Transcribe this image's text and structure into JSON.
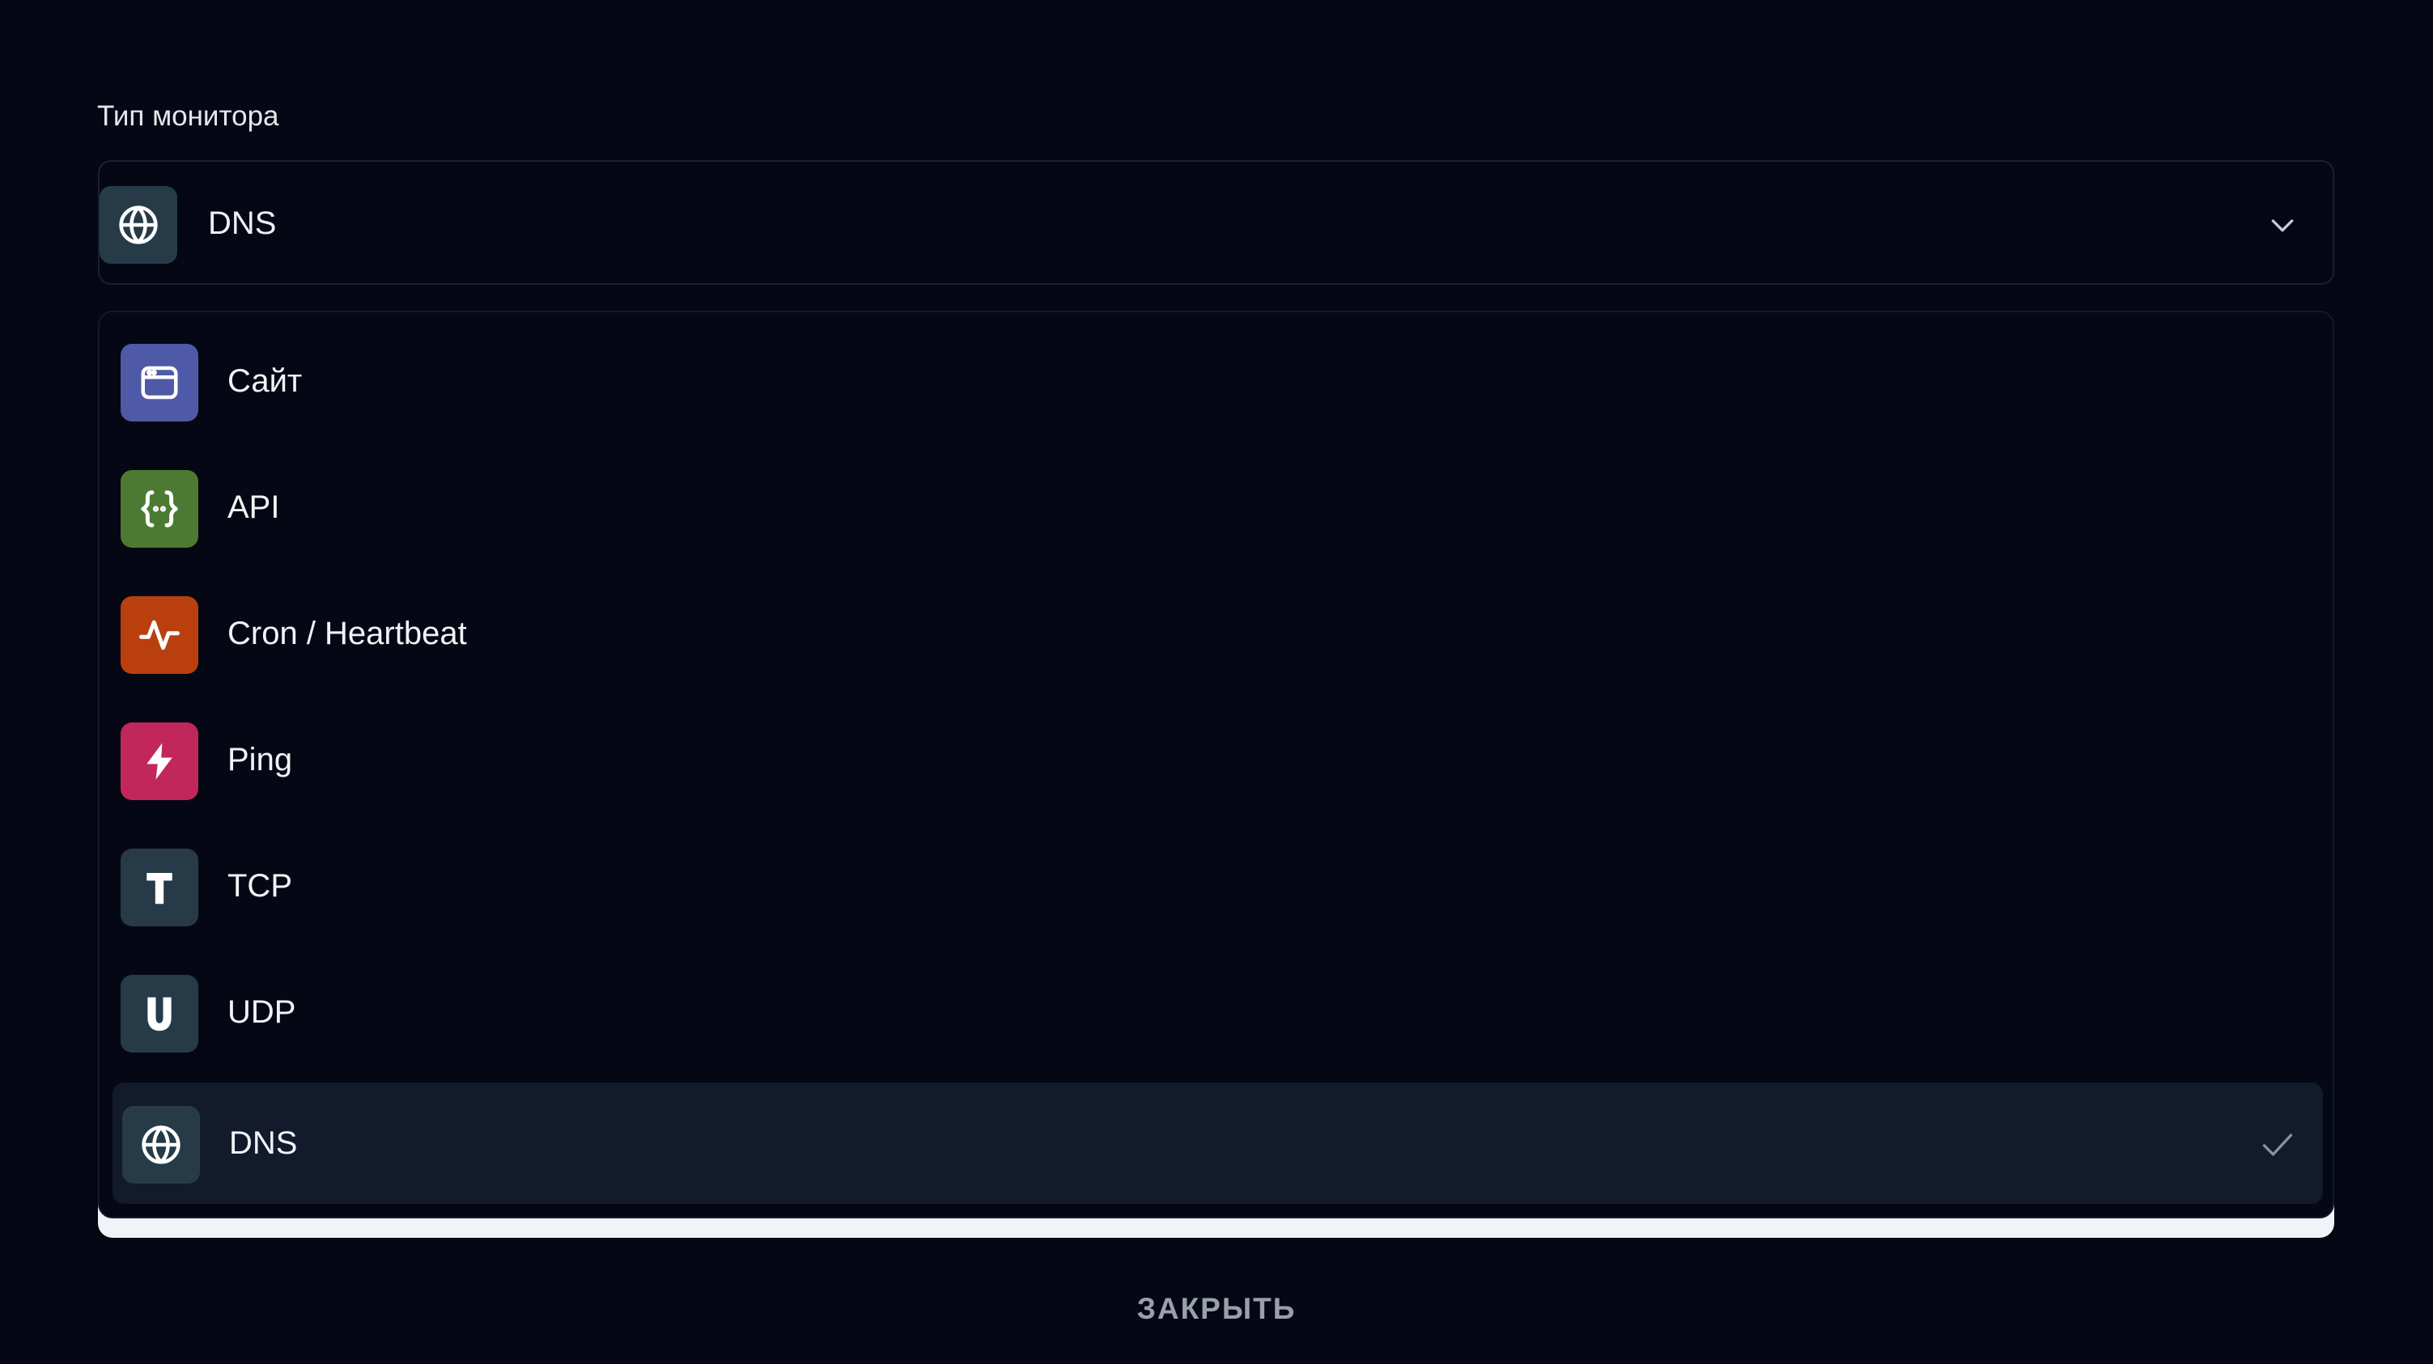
{
  "field": {
    "label": "Тип монитора",
    "selected_value": "DNS",
    "selected_icon": "globe-icon"
  },
  "options": [
    {
      "label": "Сайт",
      "icon": "browser-window-icon",
      "color": "#4e5aa8"
    },
    {
      "label": "API",
      "icon": "curly-braces-icon",
      "color": "#4c7a33"
    },
    {
      "label": "Cron / Heartbeat",
      "icon": "pulse-icon",
      "color": "#b9400e"
    },
    {
      "label": "Ping",
      "icon": "lightning-icon",
      "color": "#c1275b"
    },
    {
      "label": "TCP",
      "icon": "letter-t-icon",
      "color": "#263b47"
    },
    {
      "label": "UDP",
      "icon": "letter-u-icon",
      "color": "#263b47"
    },
    {
      "label": "DNS",
      "icon": "globe-icon",
      "color": "#263b47",
      "selected": true
    }
  ],
  "close_label": "ЗАКРЫТЬ",
  "colors": {
    "background": "#050814",
    "selected_row": "#121a2b",
    "neutral_tile": "#263b47"
  }
}
